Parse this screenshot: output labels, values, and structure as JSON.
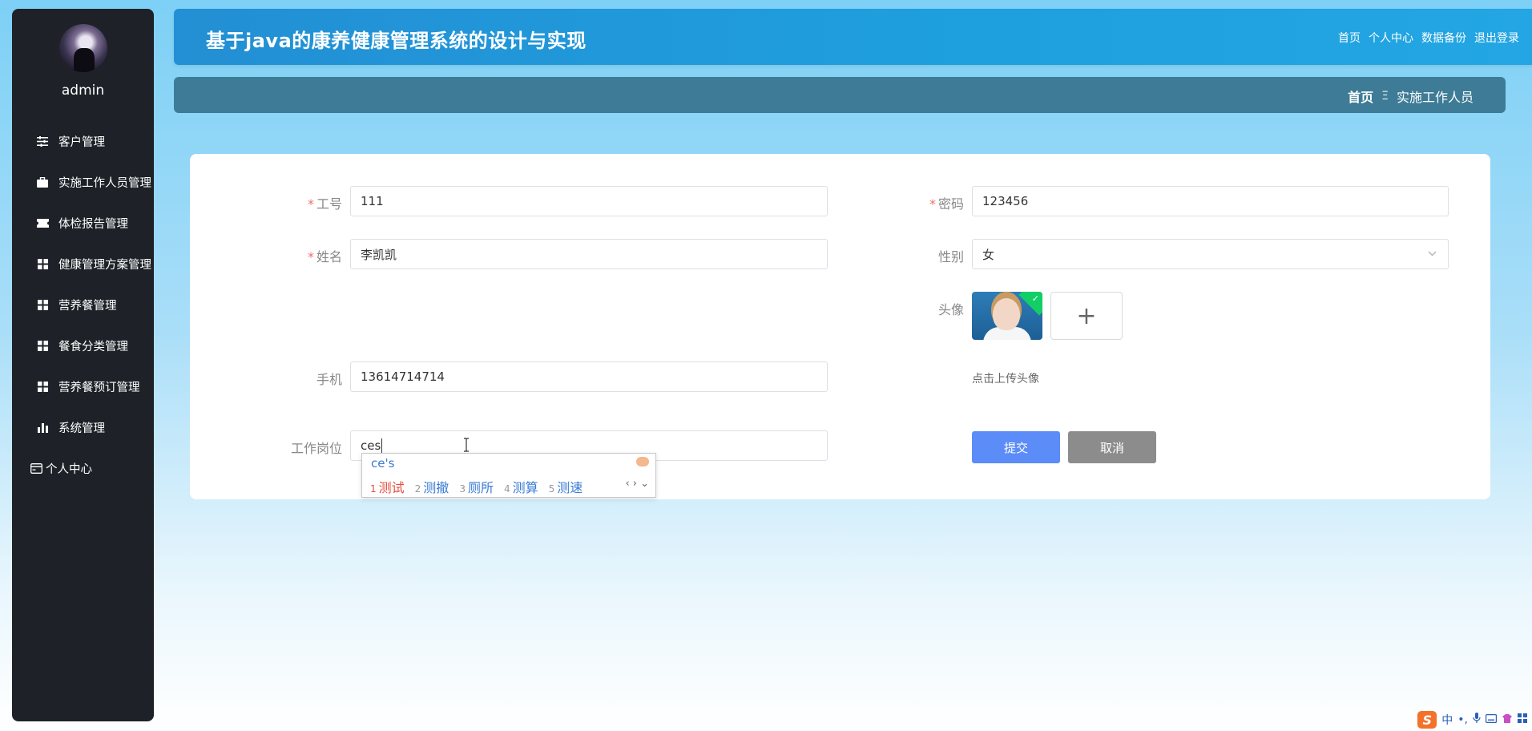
{
  "sidebar": {
    "username": "admin",
    "items": [
      {
        "label": "客户管理",
        "icon": "sliders-icon"
      },
      {
        "label": "实施工作人员管理",
        "icon": "briefcase-icon"
      },
      {
        "label": "体检报告管理",
        "icon": "ticket-icon"
      },
      {
        "label": "健康管理方案管理",
        "icon": "grid-icon"
      },
      {
        "label": "营养餐管理",
        "icon": "grid-icon"
      },
      {
        "label": "餐食分类管理",
        "icon": "grid-icon"
      },
      {
        "label": "营养餐预订管理",
        "icon": "grid-icon"
      },
      {
        "label": "系统管理",
        "icon": "bar-chart-icon"
      },
      {
        "label": "个人中心",
        "icon": "card-icon"
      }
    ]
  },
  "header": {
    "title": "基于java的康养健康管理系统的设计与实现",
    "links": [
      "首页",
      "个人中心",
      "数据备份",
      "退出登录"
    ]
  },
  "breadcrumb": {
    "home": "首页",
    "separator": "Ξ",
    "current": "实施工作人员"
  },
  "form": {
    "job_no": {
      "label": "工号",
      "value": "111",
      "required": true
    },
    "password": {
      "label": "密码",
      "value": "123456",
      "required": true
    },
    "name": {
      "label": "姓名",
      "value": "李凯凯",
      "required": true
    },
    "gender": {
      "label": "性别",
      "value": "女"
    },
    "avatar": {
      "label": "头像",
      "tip": "点击上传头像",
      "add_symbol": "+"
    },
    "phone": {
      "label": "手机",
      "value": "13614714714"
    },
    "position": {
      "label": "工作岗位",
      "value": "ces"
    },
    "submit_label": "提交",
    "cancel_label": "取消"
  },
  "ime": {
    "composition": "ce's",
    "candidates": [
      {
        "num": "1",
        "text": "测试"
      },
      {
        "num": "2",
        "text": "测撤"
      },
      {
        "num": "3",
        "text": "厕所"
      },
      {
        "num": "4",
        "text": "测算"
      },
      {
        "num": "5",
        "text": "测速"
      }
    ],
    "nav": "‹ › ⌄"
  },
  "tray": {
    "ime_logo": "S",
    "lang": "中",
    "punct": "•,"
  },
  "colors": {
    "sidebar_bg": "#1e2228",
    "header_bg": "#1ea0de",
    "crumb_bg": "#3e7b96",
    "submit": "#5b8cf7",
    "cancel": "#8c8c8c",
    "required": "#f56c6c"
  }
}
